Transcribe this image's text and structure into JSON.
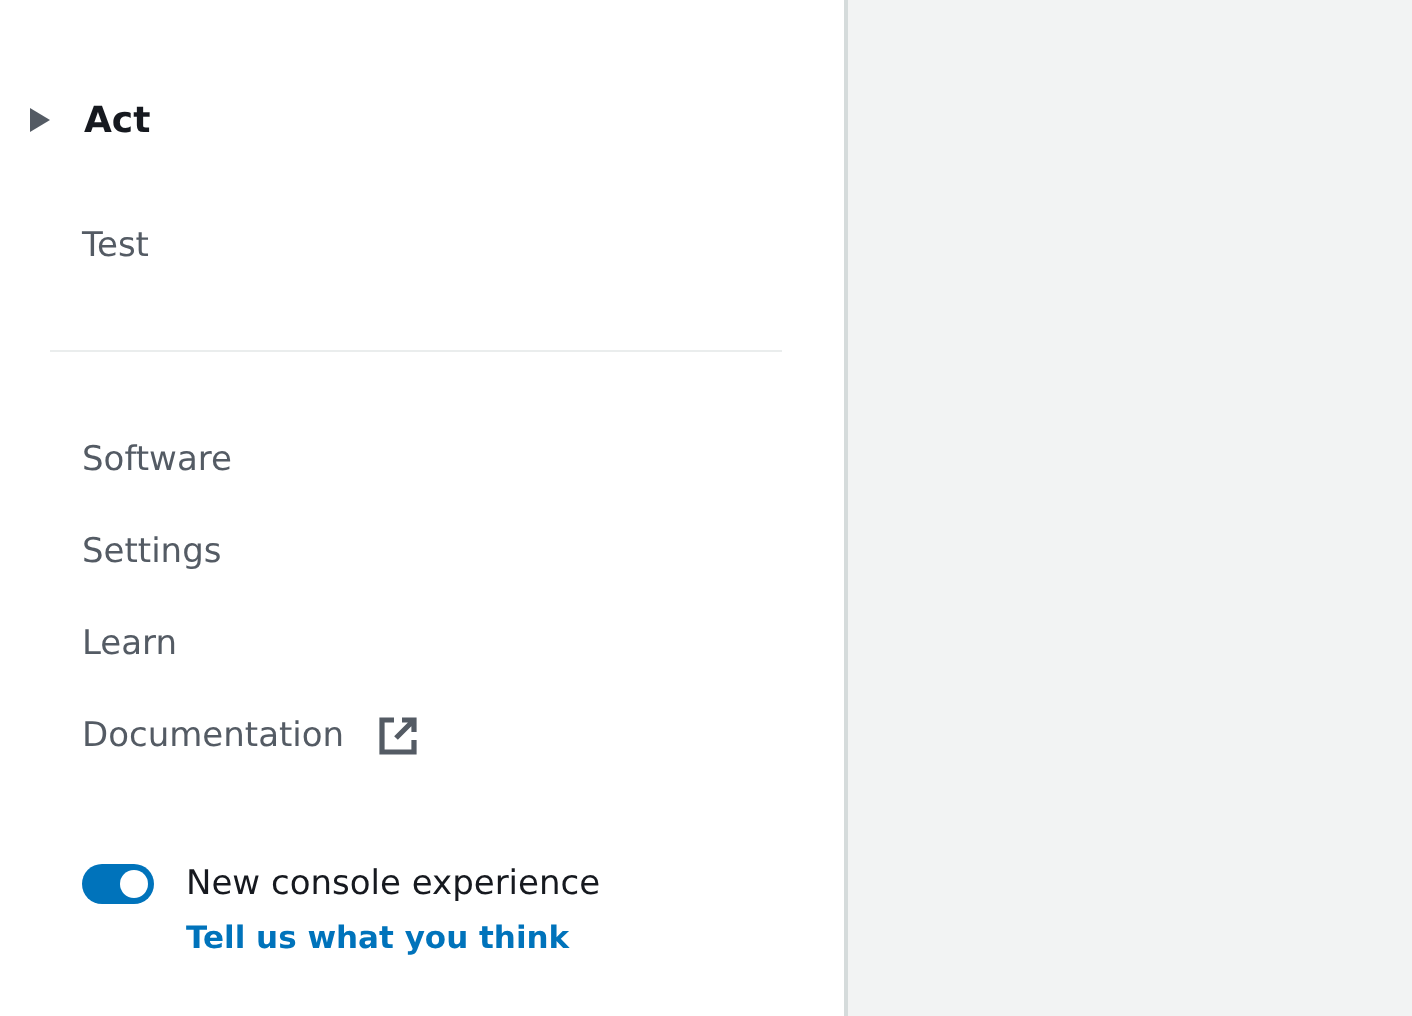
{
  "nav": {
    "top_items": [
      {
        "label": "Act",
        "kind": "group",
        "expanded": false
      },
      {
        "label": "Test",
        "kind": "link"
      }
    ],
    "items": [
      {
        "label": "Software",
        "kind": "link"
      },
      {
        "label": "Settings",
        "kind": "link"
      },
      {
        "label": "Learn",
        "kind": "link"
      },
      {
        "label": "Documentation",
        "kind": "external"
      }
    ],
    "toggle": {
      "label": "New console experience",
      "on": true
    },
    "feedback_link": "Tell us what you think"
  }
}
